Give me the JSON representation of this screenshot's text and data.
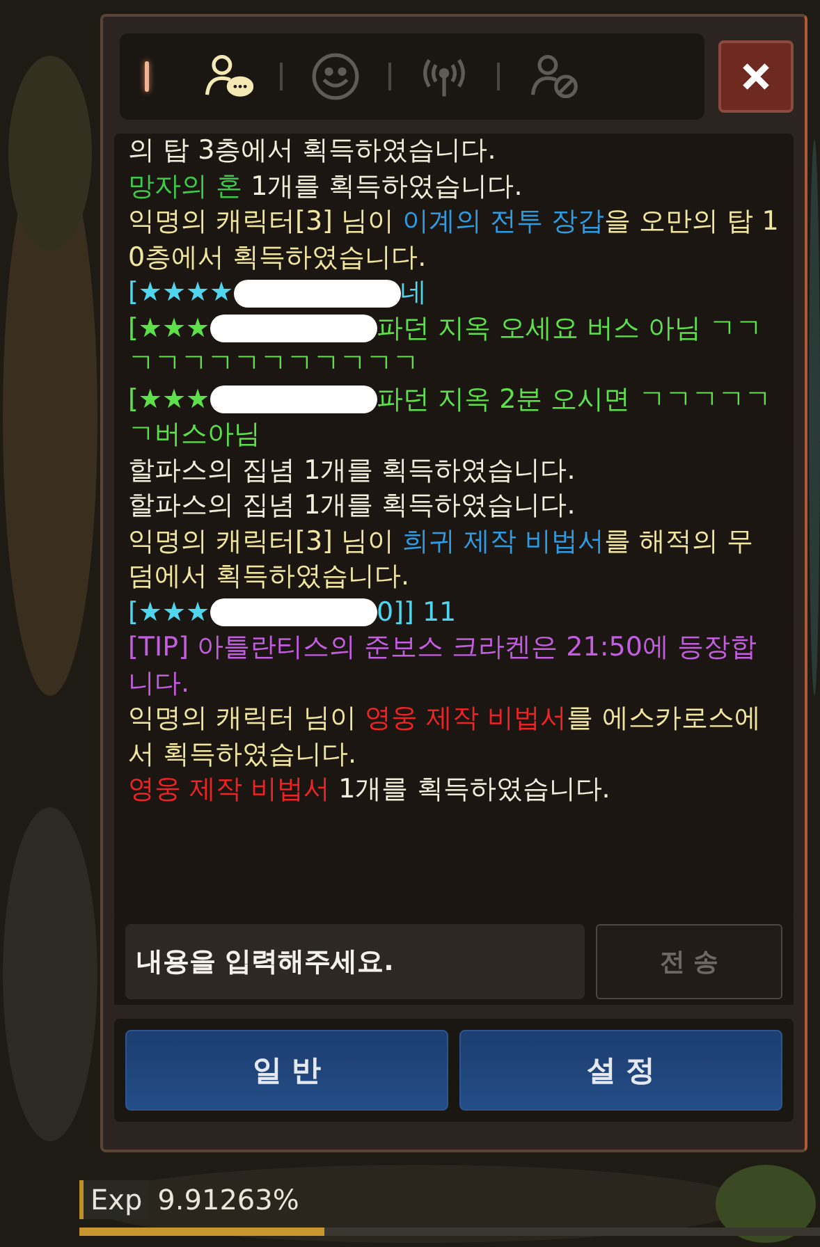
{
  "tabs": [
    {
      "kind": "party",
      "selected": true
    },
    {
      "kind": "emote",
      "selected": false
    },
    {
      "kind": "signal",
      "selected": false
    },
    {
      "kind": "block",
      "selected": false
    }
  ],
  "messages": [
    {
      "segments": [
        {
          "text": "의 탑 3층에서 획득하였습니다.",
          "color": "#f2eedc"
        }
      ]
    },
    {
      "segments": [
        {
          "text": "망자의 혼",
          "color": "#3ec94a"
        },
        {
          "text": " 1개를 획득하였습니다.",
          "color": "#f2eedc"
        }
      ]
    },
    {
      "segments": [
        {
          "text": "익명의 캐릭터[3] 님이 ",
          "color": "#f0e6a0"
        },
        {
          "text": "이계의 전투 장갑",
          "color": "#2f9be0"
        },
        {
          "text": "을 오만의 탑 10층에서 획득하였습니다.",
          "color": "#f0e6a0"
        }
      ]
    },
    {
      "segments": [
        {
          "text": "[★★★★",
          "color": "#4fd6ee"
        },
        {
          "kind": "redaction"
        },
        {
          "text": "네",
          "color": "#4fd6ee"
        }
      ]
    },
    {
      "segments": [
        {
          "text": "[★★★",
          "color": "#5ee04a"
        },
        {
          "kind": "redaction"
        },
        {
          "text": "파던 지옥 오세요 버스 아님 ㄱㄱㄱㄱㄱㄱㄱㄱㄱㄱㄱㄱㄱ",
          "color": "#5ee04a"
        }
      ]
    },
    {
      "segments": [
        {
          "text": "[★★★",
          "color": "#5ee04a"
        },
        {
          "kind": "redaction"
        },
        {
          "text": "파던 지옥 2분 오시면 ㄱㄱㄱㄱㄱㄱ버스아님",
          "color": "#5ee04a"
        }
      ]
    },
    {
      "segments": [
        {
          "text": "할파스의 집념 1개를 획득하였습니다.",
          "color": "#f2eedc"
        }
      ]
    },
    {
      "segments": [
        {
          "text": "할파스의 집념 1개를 획득하였습니다.",
          "color": "#f2eedc"
        }
      ]
    },
    {
      "segments": [
        {
          "text": "익명의 캐릭터[3] 님이 ",
          "color": "#f0e6a0"
        },
        {
          "text": "희귀 제작 비법서",
          "color": "#2f9be0"
        },
        {
          "text": "를 해적의 무덤에서 획득하였습니다.",
          "color": "#f0e6a0"
        }
      ]
    },
    {
      "segments": [
        {
          "text": "[★★★",
          "color": "#4fd6ee"
        },
        {
          "kind": "redaction"
        },
        {
          "text": "0]] 11",
          "color": "#4fd6ee"
        }
      ]
    },
    {
      "segments": [
        {
          "text": "[TIP] 아틀란티스의 준보스 크라켄은 21:50에 등장합니다.",
          "color": "#c35ee0"
        }
      ]
    },
    {
      "segments": [
        {
          "text": "익명의 캐릭터 님이 ",
          "color": "#f0e6a0"
        },
        {
          "text": "영웅 제작 비법서",
          "color": "#ee2424"
        },
        {
          "text": "를 에스카로스에서 획득하였습니다.",
          "color": "#f0e6a0"
        }
      ]
    },
    {
      "segments": [
        {
          "text": "영웅 제작 비법서",
          "color": "#ee2424"
        },
        {
          "text": " 1개를 획득하였습니다.",
          "color": "#f2eedc"
        }
      ]
    }
  ],
  "input": {
    "placeholder": "내용을 입력해주세요."
  },
  "send_button": {
    "label": "전 송",
    "disabled": true
  },
  "buttons": [
    "일 반",
    "설 정"
  ],
  "exp": {
    "label": "Exp",
    "value": "9.91263%",
    "level": 0.33
  }
}
